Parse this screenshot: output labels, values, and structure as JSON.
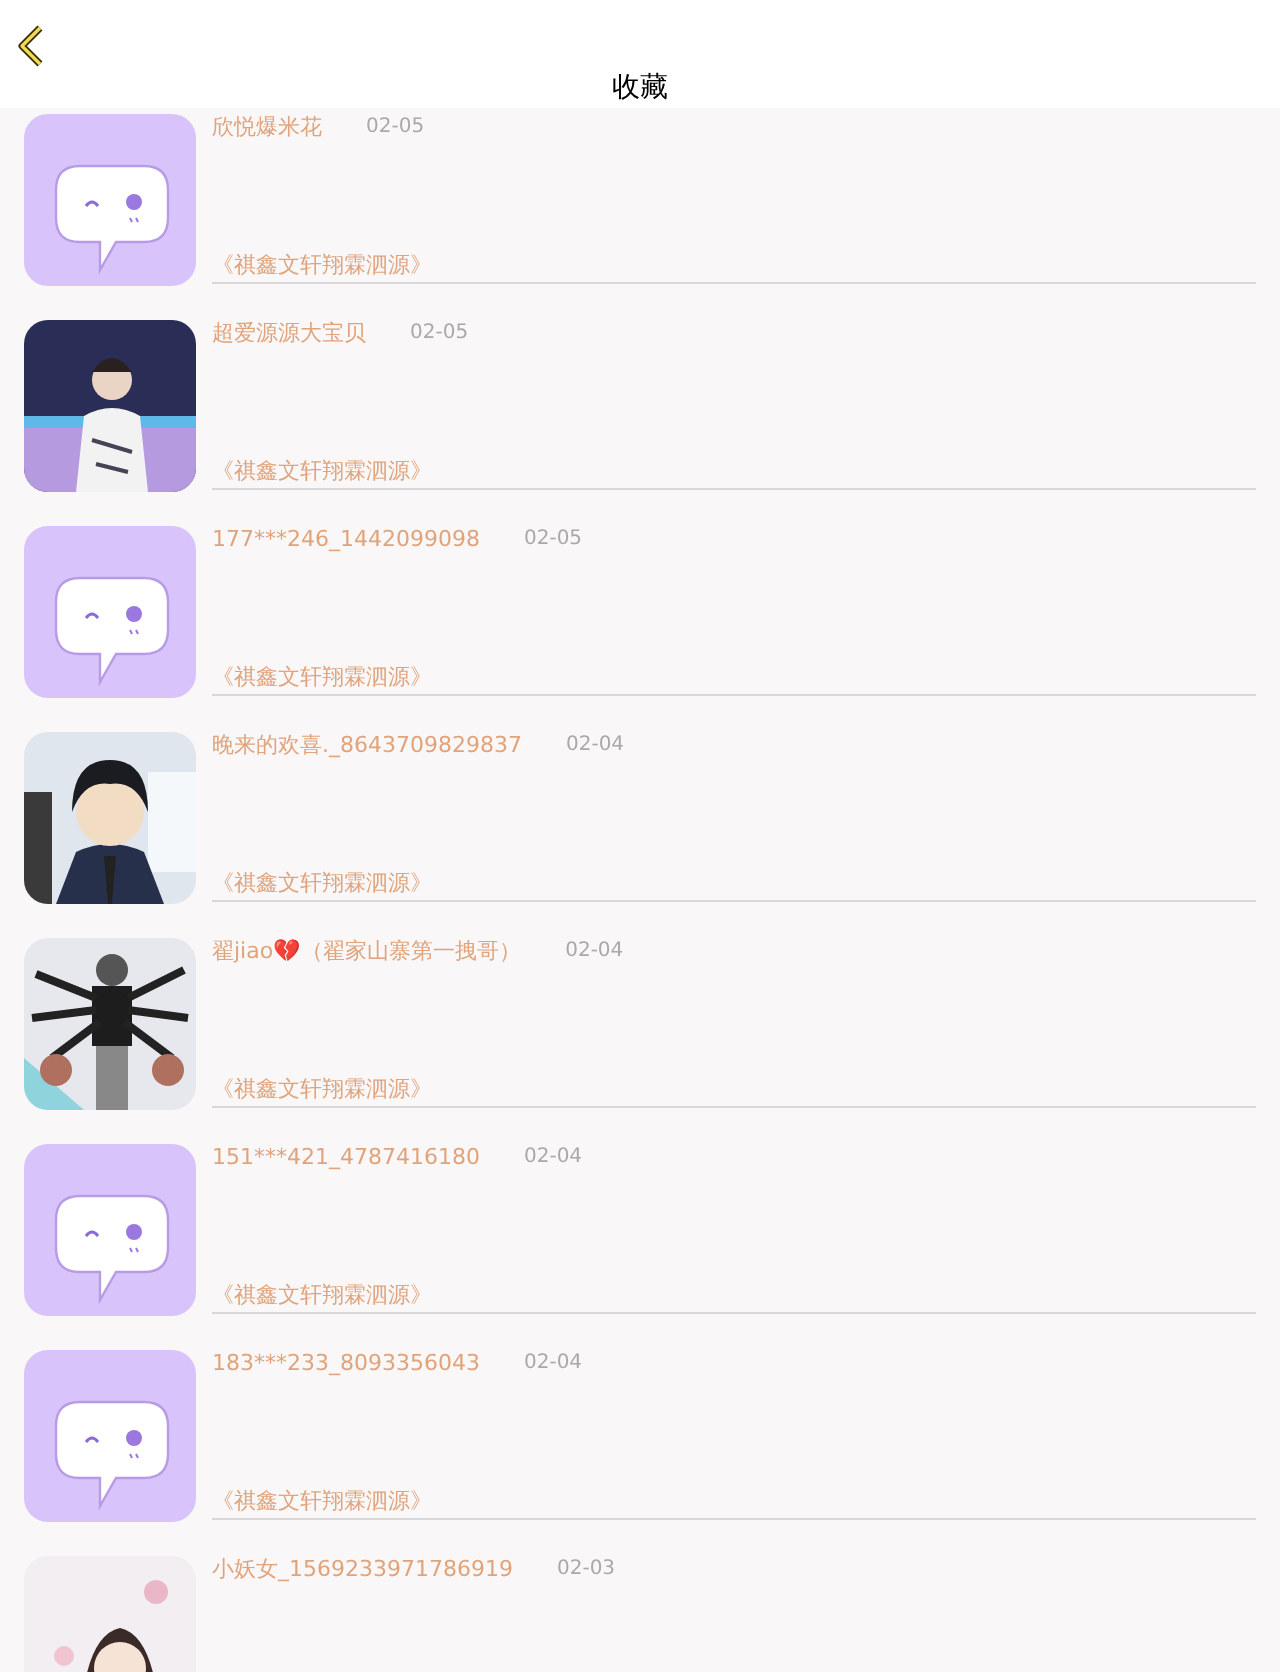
{
  "header": {
    "title": "收藏"
  },
  "items": [
    {
      "kind": "default",
      "name": "欣悦爆米花",
      "date": "02-05",
      "work": "《祺鑫文轩翔霖泗源》"
    },
    {
      "kind": "picture",
      "name": "超爱源源大宝贝",
      "date": "02-05",
      "work": "《祺鑫文轩翔霖泗源》"
    },
    {
      "kind": "default",
      "name": "177***246_1442099098",
      "date": "02-05",
      "work": "《祺鑫文轩翔霖泗源》"
    },
    {
      "kind": "picture",
      "name": "晚来的欢喜._8643709829837",
      "date": "02-04",
      "work": "《祺鑫文轩翔霖泗源》"
    },
    {
      "kind": "picture",
      "name": "翟jiao💔（翟家山寨第一拽哥）",
      "date": "02-04",
      "work": "《祺鑫文轩翔霖泗源》"
    },
    {
      "kind": "default",
      "name": "151***421_4787416180",
      "date": "02-04",
      "work": "《祺鑫文轩翔霖泗源》"
    },
    {
      "kind": "default",
      "name": "183***233_8093356043",
      "date": "02-04",
      "work": "《祺鑫文轩翔霖泗源》"
    },
    {
      "kind": "picture",
      "name": "小妖女_1569233971786919",
      "date": "02-03"
    }
  ]
}
